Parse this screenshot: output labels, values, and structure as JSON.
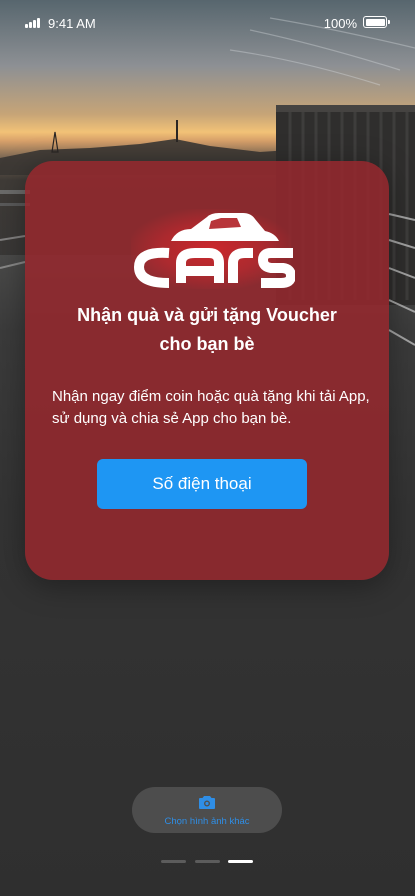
{
  "status_bar": {
    "time": "9:41 AM",
    "battery_percent": "100%",
    "signal_bars": 4
  },
  "card": {
    "logo_text": "cars",
    "title_line1": "Nhận quà và gửi tặng Voucher",
    "title_line2": "cho bạn bè",
    "description": "Nhận ngay điểm coin hoặc quà tặng khi tải App, sử dụng và chia sẻ App cho bạn bè.",
    "phone_button_label": "Số điện thoại"
  },
  "change_background": {
    "icon": "camera-icon",
    "label": "Chọn hình ảnh khác"
  },
  "pager": {
    "count": 3,
    "active_index": 2
  },
  "colors": {
    "card": "#96282d",
    "primary_button": "#1e96f3",
    "link": "#2f8ee6"
  }
}
